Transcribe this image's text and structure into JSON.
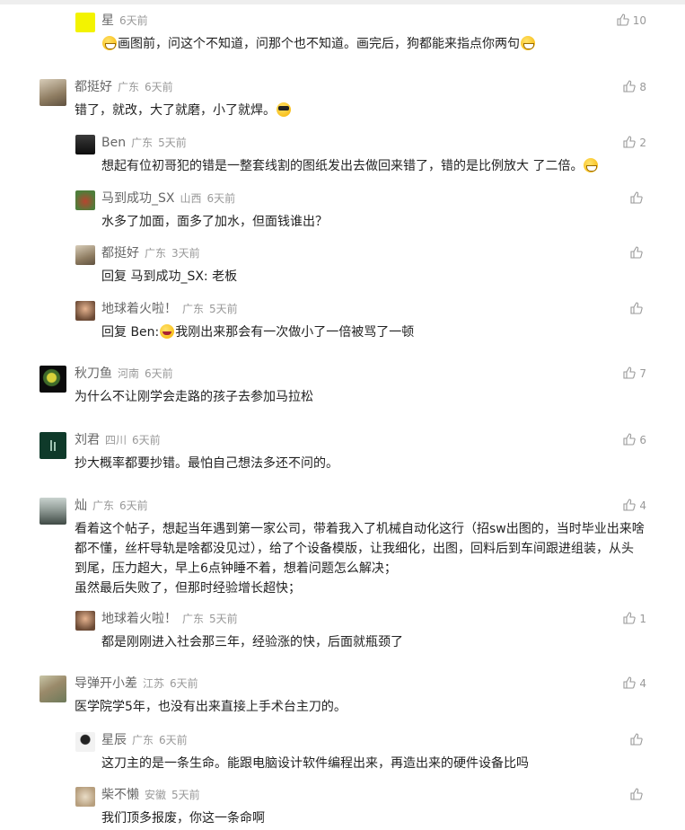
{
  "comments": [
    {
      "name": "星",
      "region": "",
      "time": "6天前",
      "likes": "10",
      "text_pre": "",
      "text": "画图前，问这个不知道，问那个也不知道。画完后，狗都能来指点你两句",
      "emoji_pre": "grin",
      "emoji_post": "grin"
    },
    {
      "name": "都挺好",
      "region": "广东",
      "time": "6天前",
      "likes": "8",
      "text": "错了，就改，大了就磨，小了就焊。",
      "emoji_post": "glasses"
    },
    {
      "name": "Ben",
      "region": "广东",
      "time": "5天前",
      "likes": "2",
      "text": "想起有位初哥犯的错是一整套线割的图纸发出去做回来错了，错的是比例放大 了二倍。",
      "emoji_post": "grin"
    },
    {
      "name": "马到成功_SX",
      "region": "山西",
      "time": "6天前",
      "likes": "",
      "text": "水多了加面，面多了加水，但面钱谁出？"
    },
    {
      "name": "都挺好",
      "region": "广东",
      "time": "3天前",
      "likes": "",
      "reply_to": "回复 马到成功_SX:",
      "text": "老板"
    },
    {
      "name": "地球着火啦！",
      "region": "广东",
      "time": "5天前",
      "likes": "",
      "reply_to": "回复 Ben:",
      "text": "我刚出来那会有一次做小了一倍被骂了一顿",
      "emoji_pre": "laugh"
    },
    {
      "name": "秋刀鱼",
      "region": "河南",
      "time": "6天前",
      "likes": "7",
      "text": "为什么不让刚学会走路的孩子去参加马拉松"
    },
    {
      "name": "刘君",
      "region": "四川",
      "time": "6天前",
      "likes": "6",
      "text": "抄大概率都要抄错。最怕自己想法多还不问的。"
    },
    {
      "name": "灿",
      "region": "广东",
      "time": "6天前",
      "likes": "4",
      "text": "看着这个帖子，想起当年遇到第一家公司，带着我入了机械自动化这行（招sw出图的，当时毕业出来啥都不懂，丝杆导轨是啥都没见过），给了个设备模版，让我细化，出图，回料后到车间跟进组装，从头到尾，压力超大，早上6点钟睡不着，想着问题怎么解决；",
      "text2": "虽然最后失败了，但那时经验增长超快；"
    },
    {
      "name": "地球着火啦！",
      "region": "广东",
      "time": "5天前",
      "likes": "1",
      "text": "都是刚刚进入社会那三年，经验涨的快，后面就瓶颈了"
    },
    {
      "name": "导弹开小差",
      "region": "江苏",
      "time": "6天前",
      "likes": "4",
      "text": "医学院学5年，也没有出来直接上手术台主刀的。"
    },
    {
      "name": "星辰",
      "region": "广东",
      "time": "6天前",
      "likes": "",
      "text": "这刀主的是一条生命。能跟电脑设计软件编程出来，再造出来的硬件设备比吗"
    },
    {
      "name": "柴不懒",
      "region": "安徽",
      "time": "5天前",
      "likes": "",
      "text": "我们顶多报废，你这一条命啊"
    }
  ],
  "colors": {
    "meta": "#999999",
    "name": "#666666",
    "text": "#222222"
  },
  "icons": {
    "like": "thumbs-up-icon"
  }
}
